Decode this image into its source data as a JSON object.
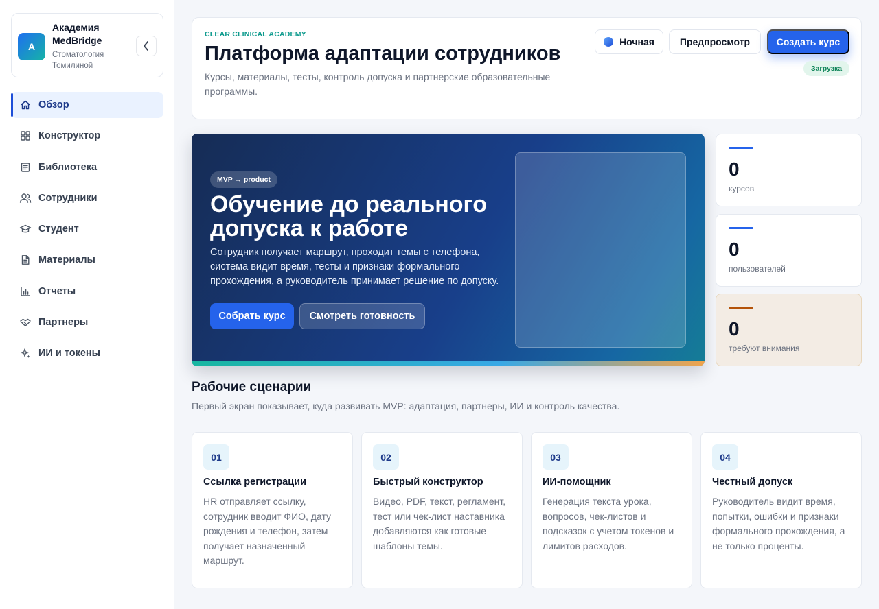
{
  "sidebar": {
    "brand": {
      "logo_letter": "A",
      "name": "Академия MedBridge",
      "subtitle": "Стоматология Томилиной"
    },
    "items": [
      {
        "label": "Обзор",
        "icon": "home-icon",
        "active": true
      },
      {
        "label": "Конструктор",
        "icon": "grid-icon",
        "active": false
      },
      {
        "label": "Библиотека",
        "icon": "book-icon",
        "active": false
      },
      {
        "label": "Сотрудники",
        "icon": "users-icon",
        "active": false
      },
      {
        "label": "Студент",
        "icon": "graduation-cap-icon",
        "active": false
      },
      {
        "label": "Материалы",
        "icon": "document-icon",
        "active": false
      },
      {
        "label": "Отчеты",
        "icon": "bar-chart-icon",
        "active": false
      },
      {
        "label": "Партнеры",
        "icon": "handshake-icon",
        "active": false
      },
      {
        "label": "ИИ и токены",
        "icon": "sparkles-icon",
        "active": false
      }
    ]
  },
  "header": {
    "eyebrow": "CLEAR CLINICAL ACADEMY",
    "title": "Платформа адаптации сотрудников",
    "description": "Курсы, материалы, тесты, контроль допуска и партнерские образовательные программы.",
    "night_label": "Ночная",
    "preview_label": "Предпросмотр",
    "create_label": "Создать курс",
    "status": "Загрузка"
  },
  "hero": {
    "chip": "MVP → product",
    "title": "Обучение до реального допуска к работе",
    "text": "Сотрудник получает маршрут, проходит темы с телефона, система видит время, тесты и признаки формального прохождения, а руководитель принимает решение по допуску.",
    "primary_label": "Собрать курс",
    "secondary_label": "Смотреть готовность"
  },
  "stats": [
    {
      "value": "0",
      "label": "курсов",
      "accent": "#2563eb"
    },
    {
      "value": "0",
      "label": "пользователей",
      "accent": "#2563eb"
    },
    {
      "value": "0",
      "label": "требуют внимания",
      "accent": "#b45309"
    }
  ],
  "scenarios": {
    "title": "Рабочие сценарии",
    "subtitle": "Первый экран показывает, куда развивать MVP: адаптация, партнеры, ИИ и контроль качества.",
    "cards": [
      {
        "num": "01",
        "title": "Ссылка регистрации",
        "text": "HR отправляет ссылку, сотрудник вводит ФИО, дату рождения и телефон, затем получает назначенный маршрут."
      },
      {
        "num": "02",
        "title": "Быстрый конструктор",
        "text": "Видео, PDF, текст, регламент, тест или чек-лист наставника добавляются как готовые шаблоны темы."
      },
      {
        "num": "03",
        "title": "ИИ-помощник",
        "text": "Генерация текста урока, вопросов, чек-листов и подсказок с учетом токенов и лимитов расходов."
      },
      {
        "num": "04",
        "title": "Честный допуск",
        "text": "Руководитель видит время, попытки, ошибки и признаки формального прохождения, а не только проценты."
      }
    ]
  },
  "colors": {
    "accent": "#2563eb",
    "teal": "#0f9b8e",
    "warning": "#b45309",
    "success_bg": "#e2f5ec"
  }
}
